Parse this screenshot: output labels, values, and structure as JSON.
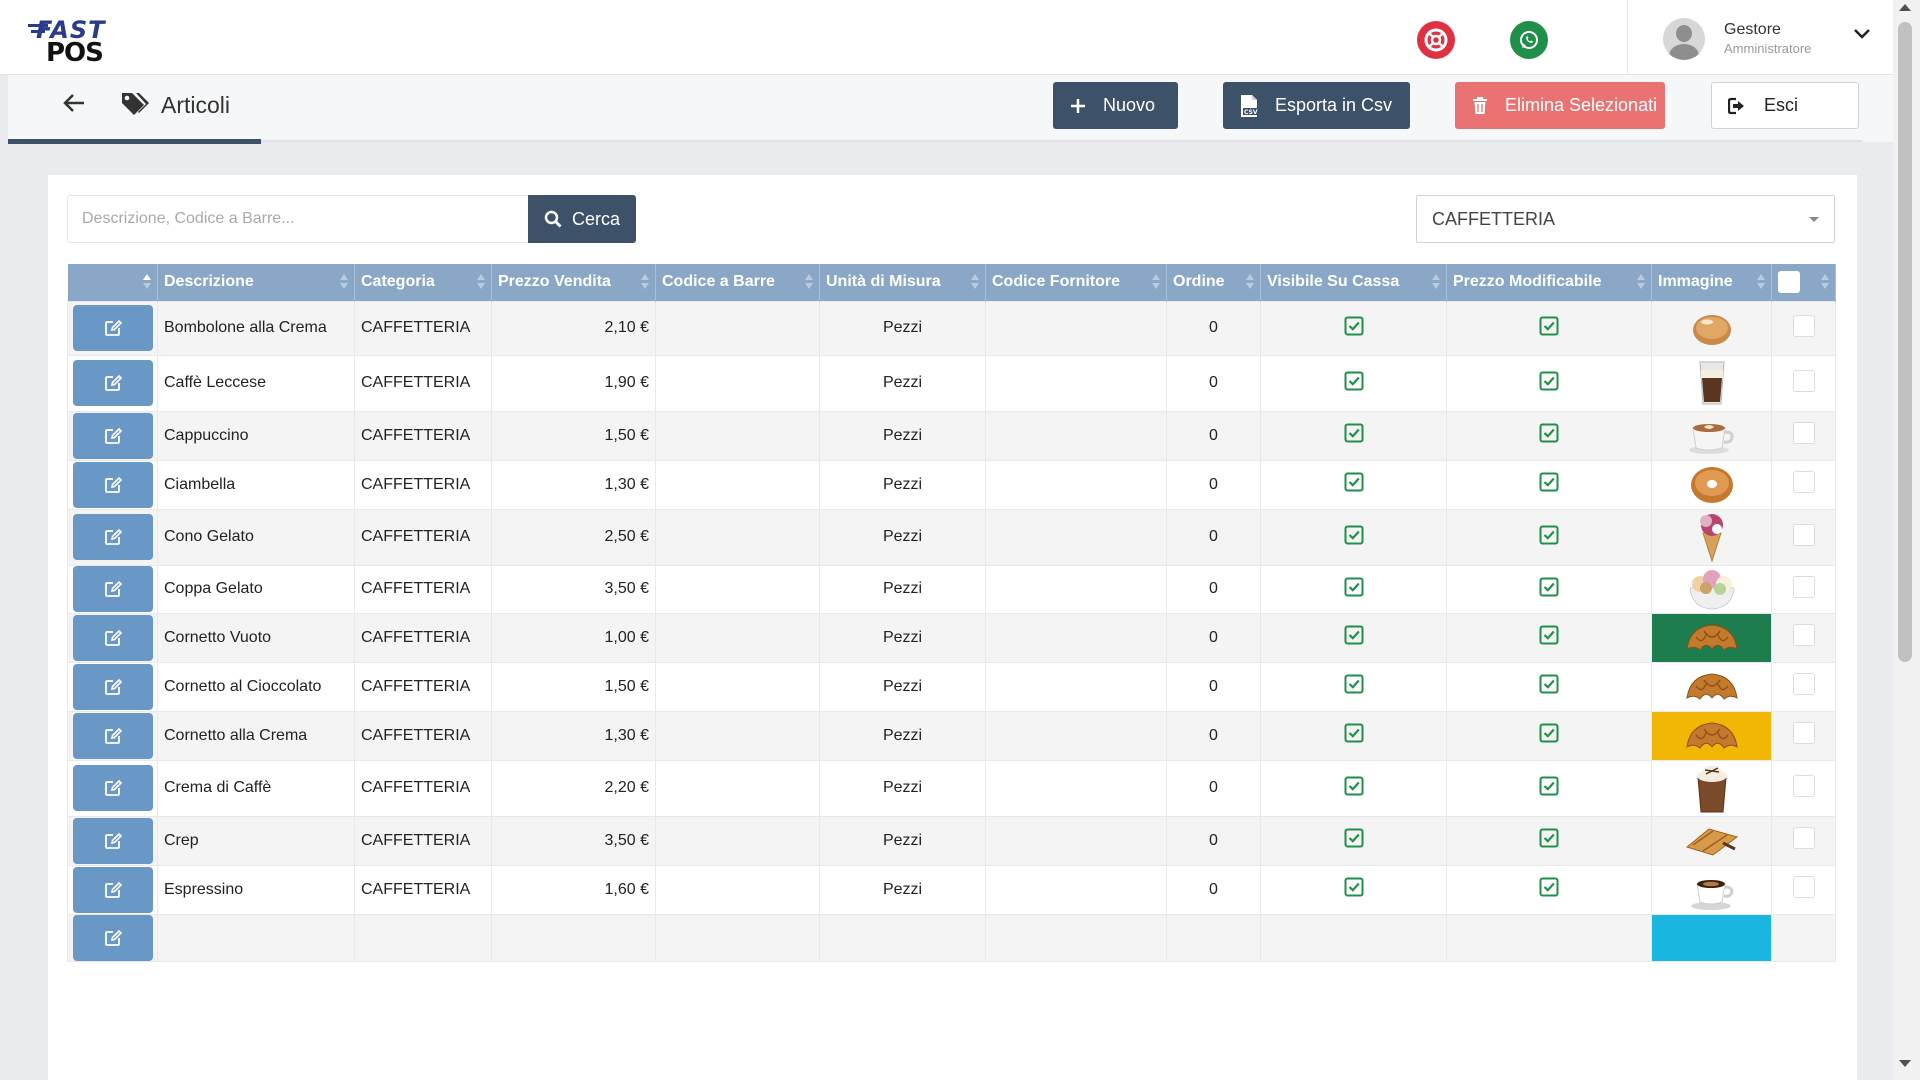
{
  "app": {
    "logo_top": "FAST",
    "logo_bottom": "POS"
  },
  "header": {
    "user_name": "Gestore",
    "user_role": "Amministratore",
    "icons": [
      "help-icon",
      "whatsapp-icon",
      "avatar",
      "chevron-down-icon"
    ]
  },
  "page": {
    "title": "Articoli"
  },
  "toolbar": {
    "new_label": "Nuovo",
    "export_label": "Esporta in Csv",
    "delete_label": "Elimina Selezionati",
    "exit_label": "Esci"
  },
  "search": {
    "placeholder": "Descrizione, Codice a Barre...",
    "value": "",
    "button_label": "Cerca"
  },
  "filter": {
    "category_selected": "CAFFETTERIA"
  },
  "colors": {
    "primary": "#3d5269",
    "danger": "#ea7272",
    "table_header": "#8aa7c8",
    "edit_button": "#6a98c6",
    "check_green": "#1f8f49"
  },
  "table": {
    "columns": [
      "",
      "Descrizione",
      "Categoria",
      "Prezzo Vendita",
      "Codice a Barre",
      "Unità di Misura",
      "Codice Fornitore",
      "Ordine",
      "Visibile Su Cassa",
      "Prezzo Modificabile",
      "Immagine",
      ""
    ],
    "rows": [
      {
        "descrizione": "Bombolone alla Crema",
        "categoria": "CAFFETTERIA",
        "prezzo": "2,10 €",
        "codice_barre": "",
        "unita": "Pezzi",
        "codice_fornitore": "",
        "ordine": "0",
        "visibile": true,
        "modificabile": true,
        "immagine": "bombolone",
        "img_bg": ""
      },
      {
        "descrizione": "Caffè Leccese",
        "categoria": "CAFFETTERIA",
        "prezzo": "1,90 €",
        "codice_barre": "",
        "unita": "Pezzi",
        "codice_fornitore": "",
        "ordine": "0",
        "visibile": true,
        "modificabile": true,
        "immagine": "iced-coffee-glass",
        "img_bg": ""
      },
      {
        "descrizione": "Cappuccino",
        "categoria": "CAFFETTERIA",
        "prezzo": "1,50 €",
        "codice_barre": "",
        "unita": "Pezzi",
        "codice_fornitore": "",
        "ordine": "0",
        "visibile": true,
        "modificabile": true,
        "immagine": "cappuccino-cup",
        "img_bg": ""
      },
      {
        "descrizione": "Ciambella",
        "categoria": "CAFFETTERIA",
        "prezzo": "1,30 €",
        "codice_barre": "",
        "unita": "Pezzi",
        "codice_fornitore": "",
        "ordine": "0",
        "visibile": true,
        "modificabile": true,
        "immagine": "donut",
        "img_bg": ""
      },
      {
        "descrizione": "Cono Gelato",
        "categoria": "CAFFETTERIA",
        "prezzo": "2,50 €",
        "codice_barre": "",
        "unita": "Pezzi",
        "codice_fornitore": "",
        "ordine": "0",
        "visibile": true,
        "modificabile": true,
        "immagine": "ice-cream-cone",
        "img_bg": ""
      },
      {
        "descrizione": "Coppa Gelato",
        "categoria": "CAFFETTERIA",
        "prezzo": "3,50 €",
        "codice_barre": "",
        "unita": "Pezzi",
        "codice_fornitore": "",
        "ordine": "0",
        "visibile": true,
        "modificabile": true,
        "immagine": "ice-cream-cup",
        "img_bg": ""
      },
      {
        "descrizione": "Cornetto Vuoto",
        "categoria": "CAFFETTERIA",
        "prezzo": "1,00 €",
        "codice_barre": "",
        "unita": "Pezzi",
        "codice_fornitore": "",
        "ordine": "0",
        "visibile": true,
        "modificabile": true,
        "immagine": "croissant",
        "img_bg": "#1e7d4f"
      },
      {
        "descrizione": "Cornetto al Cioccolato",
        "categoria": "CAFFETTERIA",
        "prezzo": "1,50 €",
        "codice_barre": "",
        "unita": "Pezzi",
        "codice_fornitore": "",
        "ordine": "0",
        "visibile": true,
        "modificabile": true,
        "immagine": "croissant",
        "img_bg": ""
      },
      {
        "descrizione": "Cornetto alla Crema",
        "categoria": "CAFFETTERIA",
        "prezzo": "1,30 €",
        "codice_barre": "",
        "unita": "Pezzi",
        "codice_fornitore": "",
        "ordine": "0",
        "visibile": true,
        "modificabile": true,
        "immagine": "croissant",
        "img_bg": "#f2b705"
      },
      {
        "descrizione": "Crema di Caffè",
        "categoria": "CAFFETTERIA",
        "prezzo": "2,20 €",
        "codice_barre": "",
        "unita": "Pezzi",
        "codice_fornitore": "",
        "ordine": "0",
        "visibile": true,
        "modificabile": true,
        "immagine": "coffee-cream-glass",
        "img_bg": ""
      },
      {
        "descrizione": "Crep",
        "categoria": "CAFFETTERIA",
        "prezzo": "3,50 €",
        "codice_barre": "",
        "unita": "Pezzi",
        "codice_fornitore": "",
        "ordine": "0",
        "visibile": true,
        "modificabile": true,
        "immagine": "crepe",
        "img_bg": ""
      },
      {
        "descrizione": "Espressino",
        "categoria": "CAFFETTERIA",
        "prezzo": "1,60 €",
        "codice_barre": "",
        "unita": "Pezzi",
        "codice_fornitore": "",
        "ordine": "0",
        "visibile": true,
        "modificabile": true,
        "immagine": "espresso-cup",
        "img_bg": ""
      },
      {
        "descrizione": "",
        "categoria": "",
        "prezzo": "",
        "codice_barre": "",
        "unita": "",
        "codice_fornitore": "",
        "ordine": "",
        "visibile": false,
        "modificabile": false,
        "immagine": "",
        "img_bg": "#19b6e0"
      }
    ]
  }
}
